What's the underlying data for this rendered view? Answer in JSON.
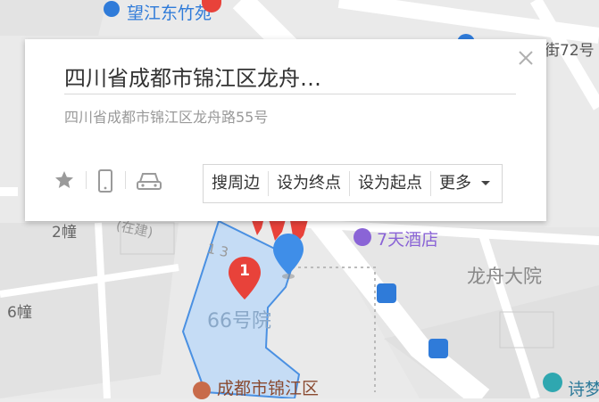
{
  "map": {
    "labels": {
      "top_poi": "望江东竹苑",
      "street_72": "街72号",
      "building_2": "2幢",
      "building_6": "6幢",
      "construction": "(在建)",
      "road_13": "1 3",
      "hotel": "7天酒店",
      "complex": "龙舟大院",
      "yard_66": "66号院",
      "district_gov": "成都市锦江区",
      "bottom_right": "诗梦"
    },
    "marker_label": "1",
    "colors": {
      "road": "#ffffff",
      "block": "#dcdcdc",
      "selection_fill": "#bcd8f7",
      "selection_stroke": "#4a90e2",
      "marker_red": "#e8423a",
      "marker_blue": "#3f8ee8",
      "poi_purple": "#8a64d6",
      "poi_blue": "#2f7bd9"
    }
  },
  "card": {
    "title": "四川省成都市锦江区龙舟…",
    "address": "四川省成都市锦江区龙舟路55号",
    "quick_icons": [
      "star-icon",
      "phone-icon",
      "car-icon"
    ],
    "actions": {
      "nearby": "搜周边",
      "set_end": "设为终点",
      "set_start": "设为起点",
      "more": "更多"
    }
  }
}
